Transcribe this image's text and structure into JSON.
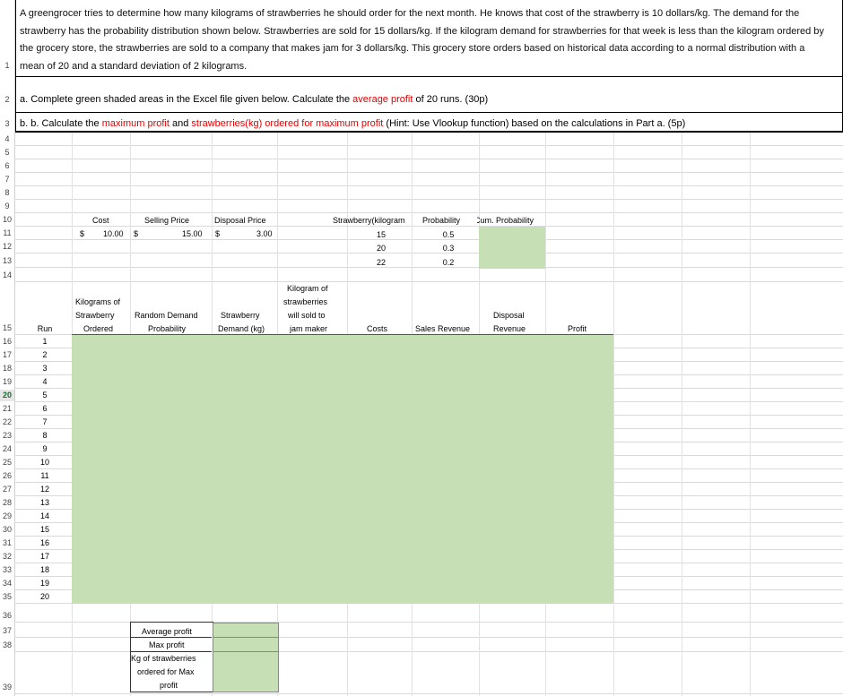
{
  "intro": "A greengrocer tries to determine how many kilograms of strawberries he should order for the next month. He knows that cost of the strawberry is 10 dollars/kg. The demand for the strawberry has the probability distribution shown below. Strawberries are sold for 15 dollars/kg. If the kilogram demand for strawberries for that week is less than the kilogram ordered by the grocery store, the strawberries are sold to a company that makes jam for 3 dollars/kg. This grocery store orders based on historical data according to a normal distribution with a mean of 20 and a standard deviation of 2 kilograms.",
  "part_a": {
    "prefix": "a. Complete green shaded areas in the Excel file given below. Calculate the ",
    "highlight": "average profit",
    "suffix": " of 20 runs. (30p)"
  },
  "part_b": {
    "prefix": "b. b. Calculate the ",
    "hl1": "maximum profit",
    "mid": " and ",
    "hl2": "strawberries(kg) ordered for maximum profit",
    "suffix": " (Hint: Use Vlookup function) based on the calculations in Part a. (5p)"
  },
  "params": {
    "cost_label": "Cost",
    "selling_label": "Selling Price",
    "disposal_label": "Disposal Price",
    "dollar": "$",
    "cost_value": "10.00",
    "selling_value": "15.00",
    "disposal_value": "3.00"
  },
  "dist": {
    "h1": "Strawberry(kilogram",
    "h2": "Probability",
    "h3": "Cum. Probability",
    "rows": [
      {
        "kg": "15",
        "p": "0.5"
      },
      {
        "kg": "20",
        "p": "0.3"
      },
      {
        "kg": "22",
        "p": "0.2"
      }
    ]
  },
  "table_headers": {
    "run": "Run",
    "kg_ordered": [
      "Kilograms of",
      "Strawberry",
      "Ordered"
    ],
    "random_demand": [
      "Random Demand",
      "Probability"
    ],
    "demand": [
      "Strawberry",
      "Demand (kg)"
    ],
    "jam": [
      "Kilogram of",
      "strawberries",
      "will sold to",
      "jam maker"
    ],
    "costs": "Costs",
    "sales": "Sales Revenue",
    "disposal": [
      "Disposal",
      "Revenue"
    ],
    "profit": "Profit"
  },
  "runs": [
    "1",
    "2",
    "3",
    "4",
    "5",
    "6",
    "7",
    "8",
    "9",
    "10",
    "11",
    "12",
    "13",
    "14",
    "15",
    "16",
    "17",
    "18",
    "19",
    "20"
  ],
  "summary": {
    "avg": "Average profit",
    "max": "Max profit",
    "kg1": "Kg of strawberries",
    "kg2": "ordered for Max",
    "kg3": "profit"
  },
  "row_numbers": [
    "1",
    "2",
    "3",
    "4",
    "5",
    "6",
    "7",
    "8",
    "9",
    "10",
    "11",
    "12",
    "13",
    "14",
    "15",
    "16",
    "17",
    "18",
    "19",
    "20",
    "21",
    "22",
    "23",
    "24",
    "25",
    "26",
    "27",
    "28",
    "29",
    "30",
    "31",
    "32",
    "33",
    "34",
    "35",
    "36",
    "37",
    "38",
    "39"
  ],
  "selected_row": "20",
  "colors": {
    "fill_green": "#c6dfb4",
    "highlight_red": "#e60000"
  }
}
